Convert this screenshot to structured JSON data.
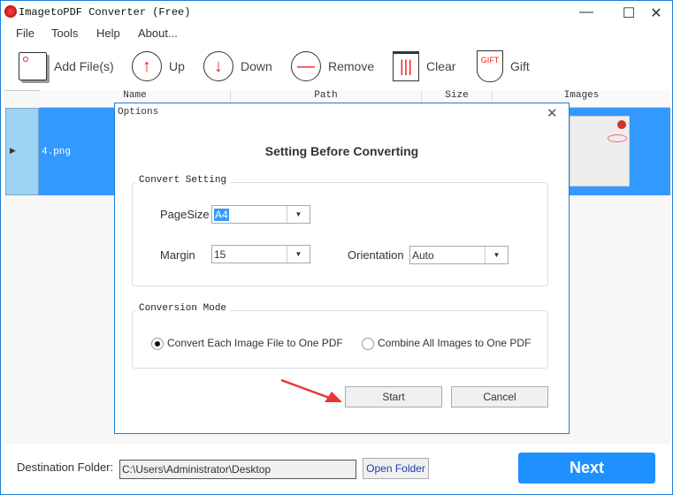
{
  "window": {
    "title": "ImagetoPDF Converter (Free)",
    "minimize": "—",
    "maximize": "☐",
    "close": "✕"
  },
  "menu": [
    "File",
    "Tools",
    "Help",
    "About..."
  ],
  "toolbar": {
    "add": "Add File(s)",
    "up": "Up",
    "down": "Down",
    "remove": "Remove",
    "clear": "Clear",
    "gift": "Gift",
    "gift_badge": "GIFT"
  },
  "table": {
    "columns": [
      "Name",
      "Path",
      "Size",
      "Images"
    ],
    "rows": [
      {
        "name": "4.png"
      }
    ]
  },
  "dialog": {
    "title": "Options",
    "heading": "Setting Before Converting",
    "convert_setting": "Convert Setting",
    "pagesize_label": "PageSize",
    "pagesize": "A4",
    "margin_label": "Margin",
    "margin": "15",
    "orientation_label": "Orientation",
    "orientation": "Auto",
    "conversion_mode": "Conversion Mode",
    "mode_each": "Convert Each Image File to One PDF",
    "mode_combine": "Combine All Images to One PDF",
    "start": "Start",
    "cancel": "Cancel",
    "close": "✕"
  },
  "footer": {
    "dest_label": "Destination Folder:",
    "dest_value": "C:\\Users\\Administrator\\Desktop",
    "open_folder": "Open Folder",
    "next": "Next"
  },
  "colors": {
    "accent": "#1e90ff",
    "selection": "#3399ff",
    "border": "#1e7ed8"
  }
}
